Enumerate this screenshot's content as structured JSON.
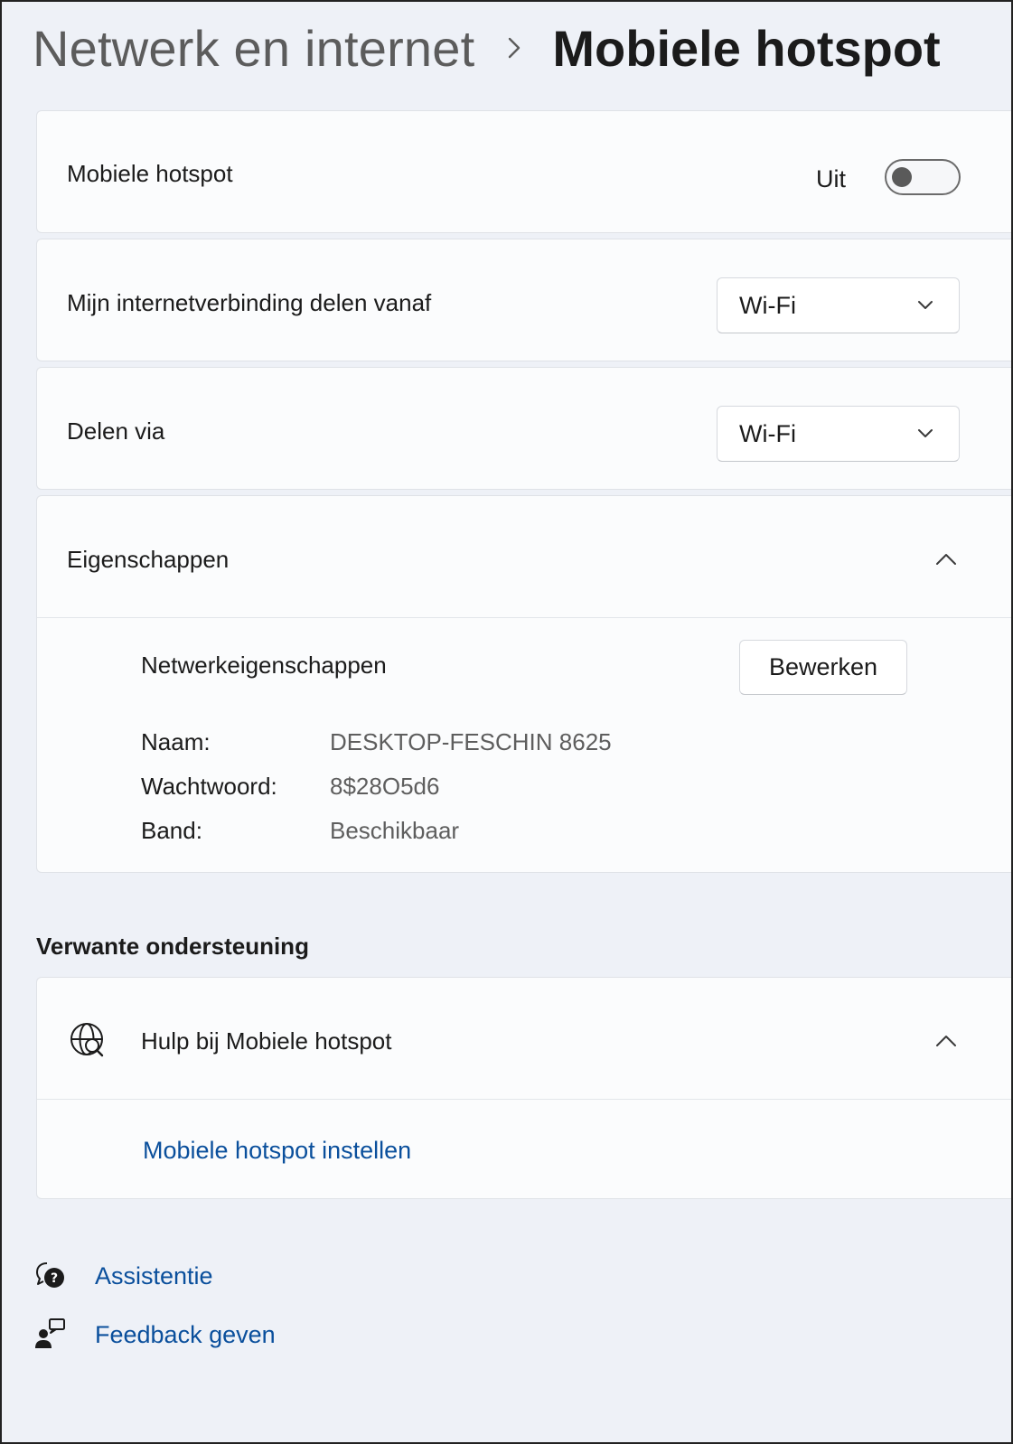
{
  "breadcrumb": {
    "parent": "Netwerk en internet",
    "current": "Mobiele hotspot"
  },
  "hotspot_toggle": {
    "label": "Mobiele hotspot",
    "state": "Uit",
    "on": false
  },
  "share_from": {
    "label": "Mijn internetverbinding delen vanaf",
    "value": "Wi-Fi"
  },
  "share_via": {
    "label": "Delen via",
    "value": "Wi-Fi"
  },
  "properties": {
    "label": "Eigenschappen",
    "expanded": true,
    "network_title": "Netwerkeigenschappen",
    "edit_label": "Bewerken",
    "rows": [
      {
        "label": "Naam:",
        "value": "DESKTOP-FESCHIN 8625"
      },
      {
        "label": "Wachtwoord:",
        "value": "8$28O5d6"
      },
      {
        "label": "Band:",
        "value": "Beschikbaar"
      }
    ]
  },
  "related_support": {
    "heading": "Verwante ondersteuning",
    "help_title": "Hulp bij Mobiele hotspot",
    "help_icon": "globe-search-icon",
    "expanded": true,
    "link": "Mobiele hotspot instellen"
  },
  "footer": {
    "assist_label": "Assistentie",
    "assist_icon": "help-chat-icon",
    "feedback_label": "Feedback geven",
    "feedback_icon": "feedback-person-icon"
  },
  "colors": {
    "background": "#eef1f7",
    "card": "#fbfcfd",
    "link": "#0a4f9c"
  }
}
